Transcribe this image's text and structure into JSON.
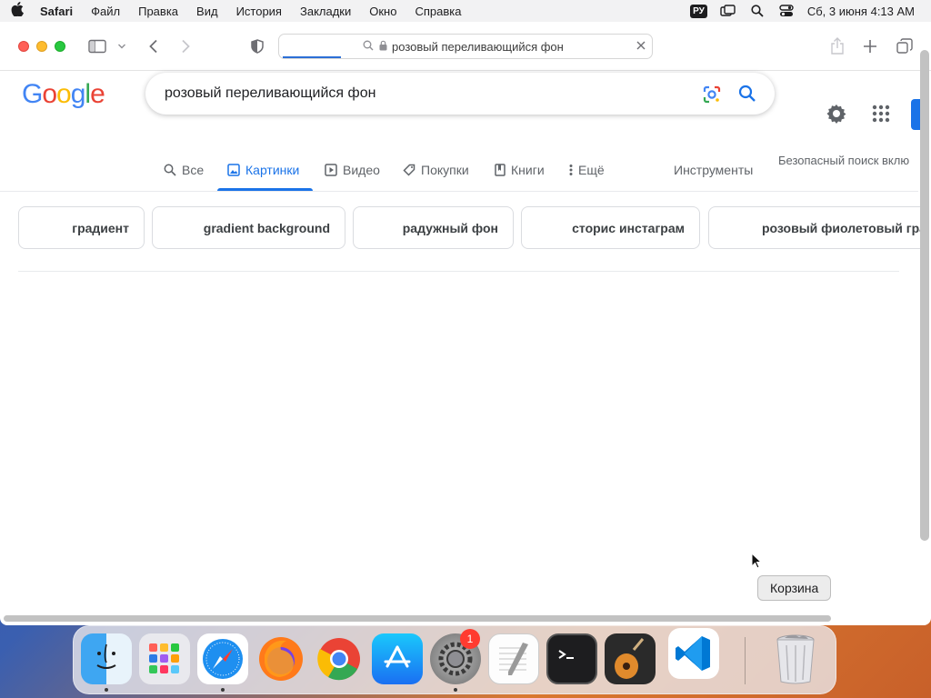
{
  "menubar": {
    "app_name": "Safari",
    "items": [
      "Файл",
      "Правка",
      "Вид",
      "История",
      "Закладки",
      "Окно",
      "Справка"
    ],
    "keyboard_layout": "РУ",
    "datetime": "Сб, 3 июня  4:13 AM"
  },
  "browser": {
    "address_text": "розовый переливающийся фон"
  },
  "google": {
    "logo": [
      "G",
      "o",
      "o",
      "g",
      "l",
      "e"
    ],
    "query": "розовый переливающийся фон",
    "tabs": [
      {
        "label": "Все",
        "icon": "search-icon"
      },
      {
        "label": "Картинки",
        "icon": "image-icon",
        "active": true
      },
      {
        "label": "Видео",
        "icon": "play-icon"
      },
      {
        "label": "Покупки",
        "icon": "tag-icon"
      },
      {
        "label": "Книги",
        "icon": "book-icon"
      },
      {
        "label": "Ещё",
        "icon": "more-vert-icon"
      }
    ],
    "tools_label": "Инструменты",
    "safesearch_label": "Безопасный поиск вклю",
    "chips": [
      "градиент",
      "gradient background",
      "радужный фон",
      "сторис инстаграм",
      "розовый фиолетовый гра"
    ]
  },
  "tooltip": "Корзина",
  "dock": {
    "apps": [
      "Finder",
      "Launchpad",
      "Safari",
      "Firefox",
      "Chrome",
      "App Store",
      "System Preferences",
      "TextEdit",
      "Terminal",
      "GarageBand",
      "Visual Studio Code",
      "Trash"
    ],
    "settings_badge": "1"
  },
  "colors": {
    "google_blue": "#1a73e8",
    "red": "#ff5f57",
    "yellow": "#febc2e",
    "green": "#28c840"
  }
}
